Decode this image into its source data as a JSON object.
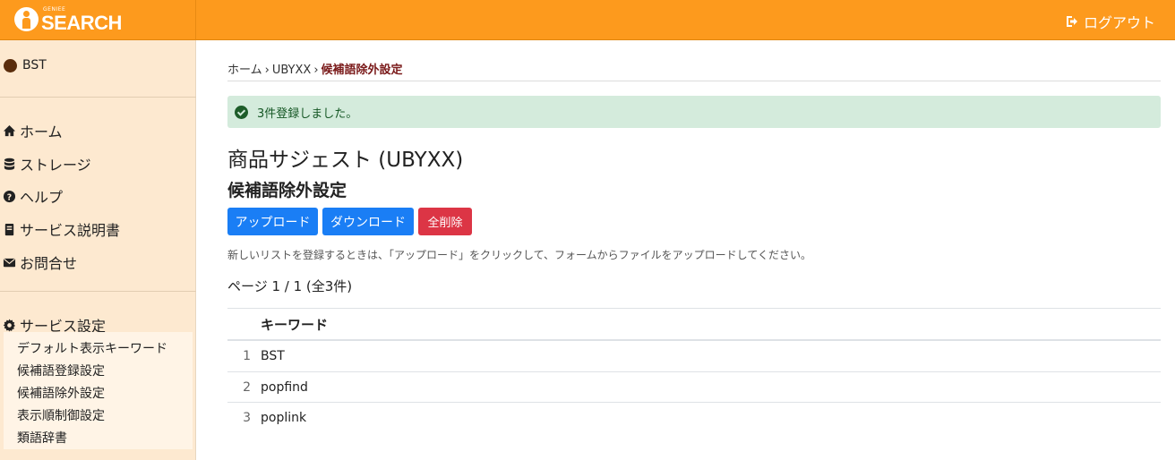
{
  "header": {
    "logo_small": "GENIEE",
    "logo_big": "SEARCH",
    "logout_label": "ログアウト"
  },
  "sidebar": {
    "user": "BST",
    "nav": [
      {
        "label": "ホーム",
        "icon": "home-icon"
      },
      {
        "label": "ストレージ",
        "icon": "database-icon"
      },
      {
        "label": "ヘルプ",
        "icon": "question-circle-icon"
      },
      {
        "label": "サービス説明書",
        "icon": "book-icon"
      },
      {
        "label": "お問合せ",
        "icon": "envelope-icon"
      }
    ],
    "settings": {
      "label": "サービス設定",
      "icon": "gear-icon",
      "items": [
        "デフォルト表示キーワード",
        "候補語登録設定",
        "候補語除外設定",
        "表示順制御設定",
        "類語辞書"
      ]
    }
  },
  "breadcrumb": {
    "home": "ホーム",
    "site": "UBYXX",
    "current": "候補語除外設定",
    "separator": "›"
  },
  "alert": {
    "message": "3件登録しました。"
  },
  "page": {
    "title": "商品サジェスト (UBYXX)",
    "subtitle": "候補語除外設定",
    "buttons": {
      "upload": "アップロード",
      "download": "ダウンロード",
      "delete_all": "全削除"
    },
    "help_text": "新しいリストを登録するときは、「アップロード」をクリックして、フォームからファイルをアップロードしてください。",
    "page_info": "ページ 1 / 1 (全3件)"
  },
  "table": {
    "header": "キーワード",
    "rows": [
      {
        "num": "1",
        "keyword": "BST"
      },
      {
        "num": "2",
        "keyword": "popfind"
      },
      {
        "num": "3",
        "keyword": "poplink"
      }
    ]
  },
  "colors": {
    "header_bg": "#fd9a1d",
    "sidebar_bg": "#fde9d0",
    "primary": "#1a7ef5",
    "danger": "#dc3545",
    "success_bg": "#d4ebdc"
  }
}
